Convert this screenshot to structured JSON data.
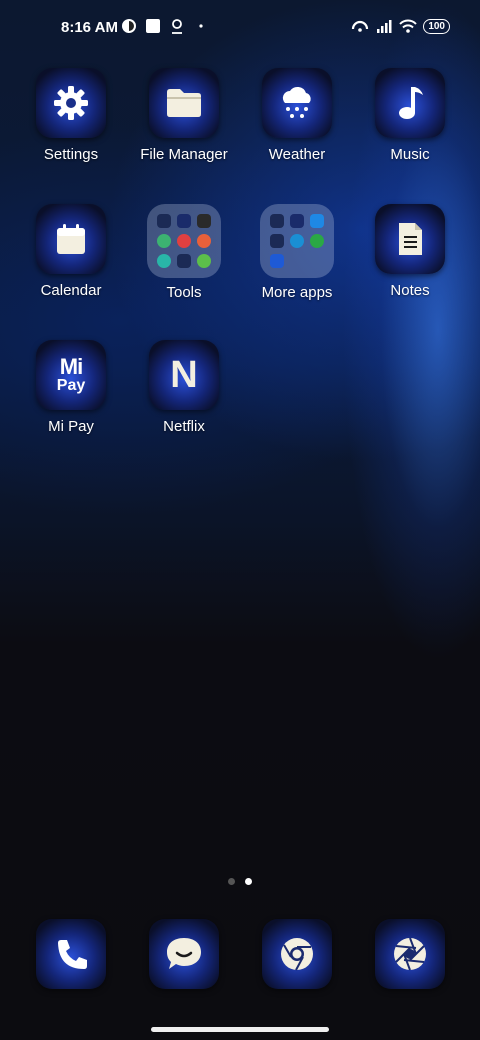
{
  "status_bar": {
    "time": "8:16 AM",
    "battery": "100"
  },
  "home_apps": [
    {
      "label": "Settings",
      "icon": "gear-icon"
    },
    {
      "label": "File Manager",
      "icon": "folder-icon"
    },
    {
      "label": "Weather",
      "icon": "cloud-snow-icon"
    },
    {
      "label": "Music",
      "icon": "music-note-icon"
    },
    {
      "label": "Calendar",
      "icon": "calendar-icon"
    },
    {
      "label": "Tools",
      "icon": "folder-grid"
    },
    {
      "label": "More apps",
      "icon": "folder-grid"
    },
    {
      "label": "Notes",
      "icon": "document-icon"
    },
    {
      "label": "Mi Pay",
      "icon": "mi-pay-icon",
      "icon_text_top": "Mi",
      "icon_text_bottom": "Pay"
    },
    {
      "label": "Netflix",
      "icon": "netflix-icon",
      "icon_text": "N"
    }
  ],
  "dock_apps": [
    {
      "label": "Phone",
      "icon": "phone-icon"
    },
    {
      "label": "Messages",
      "icon": "message-icon"
    },
    {
      "label": "Chrome",
      "icon": "chrome-icon"
    },
    {
      "label": "Camera",
      "icon": "aperture-icon"
    }
  ],
  "pages": {
    "count": 2,
    "active": 2
  }
}
